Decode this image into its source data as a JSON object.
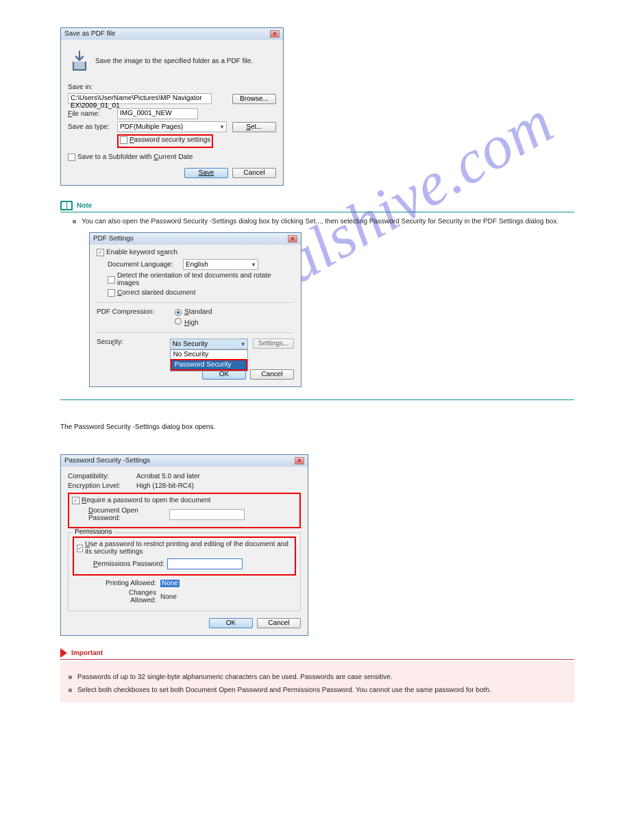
{
  "watermark": "manualshive.com",
  "dlg1": {
    "title": "Save as PDF file",
    "desc": "Save the image to the specified folder as a PDF file.",
    "savein_lbl": "Save in:",
    "savein_val": "C:\\Users\\UserName\\Pictures\\MP Navigator EX\\2009_01_01",
    "browse": "Browse...",
    "filename_lbl": "File name:",
    "filename_val": "IMG_0001_NEW",
    "type_lbl": "Save as  type:",
    "type_val": "PDF(Multiple Pages)",
    "set": "Set...",
    "pwsec": "Password security settings",
    "subfolder": "Save to a Subfolder with Current Date",
    "save": "Save",
    "cancel": "Cancel"
  },
  "note": {
    "title": "Note",
    "item": "You can also open the Password Security -Settings dialog box by clicking Set..., then selecting Password Security for Security in the PDF Settings dialog box."
  },
  "dlg2": {
    "title": "PDF Settings",
    "ekw": "Enable keyword search",
    "doclang_lbl": "Document Language:",
    "doclang_val": "English",
    "detect": "Detect the orientation of text documents and rotate images",
    "correct": "Correct slanted document",
    "comp_lbl": "PDF Compression:",
    "comp_std": "Standard",
    "comp_high": "High",
    "security_lbl": "Security:",
    "sec_val": "No Security",
    "sec_opt1": "No Security",
    "sec_opt2": "Password Security",
    "settings": "Settings...",
    "ok": "OK",
    "cancel": "Cancel"
  },
  "step3": "The Password Security -Settings dialog box opens.",
  "dlg3": {
    "title": "Password Security -Settings",
    "compat_lbl": "Compatibility:",
    "compat_val": "Acrobat 5.0 and later",
    "enc_lbl": "Encryption Level:",
    "enc_val": "High (128-bit-RC4)",
    "req": "Require a password to open the document",
    "docopen_lbl": "Document Open Password:",
    "perm_lbl": "Permissions",
    "useperm": "Use a password to restrict printing and editing of the document and its security settings",
    "permpw_lbl": "Permissions Password:",
    "printing_lbl": "Printing Allowed:",
    "printing_val": "None",
    "changes_lbl": "Changes Allowed:",
    "changes_val": "None",
    "ok": "OK",
    "cancel": "Cancel"
  },
  "important": {
    "title": "Important",
    "item1": "Passwords of up to 32 single-byte alphanumeric characters can be used. Passwords are case sensitive.",
    "item2": "Select both checkboxes to set both Document Open Password and Permissions Password. You cannot use the same password for both."
  }
}
